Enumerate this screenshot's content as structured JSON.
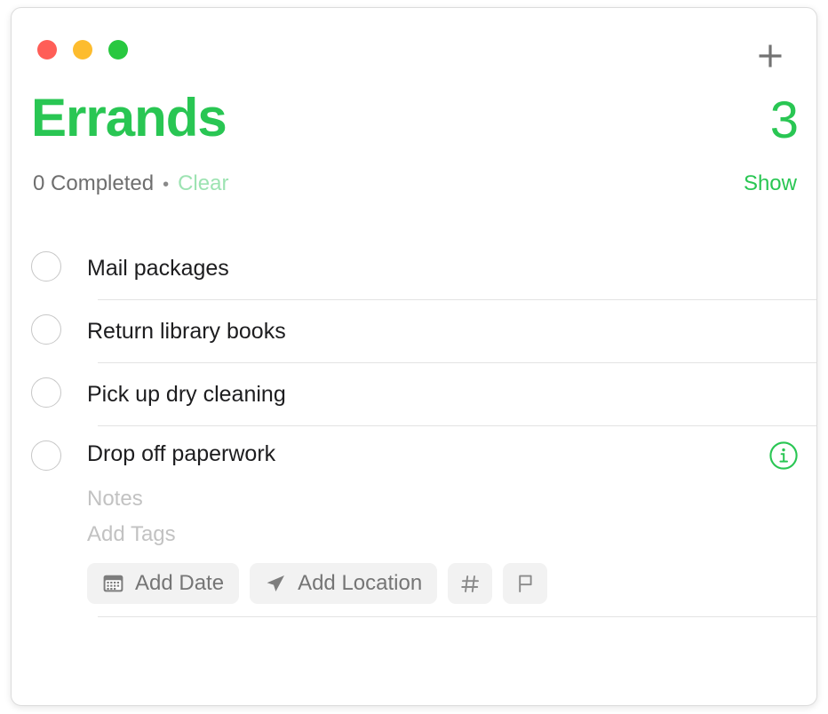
{
  "window": {
    "traffic_lights": [
      {
        "name": "close",
        "color": "#ff5e57"
      },
      {
        "name": "minimize",
        "color": "#fdbc2e"
      },
      {
        "name": "maximize",
        "color": "#28c840"
      }
    ],
    "add_icon": "plus-icon"
  },
  "header": {
    "title": "Errands",
    "count": "3",
    "accent_color": "#29c653"
  },
  "meta": {
    "completed_label": "0 Completed",
    "separator_dot": "•",
    "clear_label": "Clear",
    "clear_color": "#9de3b2",
    "show_label": "Show"
  },
  "tasks": [
    {
      "title": "Mail packages",
      "checked": false
    },
    {
      "title": "Return library books",
      "checked": false
    },
    {
      "title": "Pick up dry cleaning",
      "checked": false
    },
    {
      "title": "Drop off paperwork",
      "checked": false,
      "expanded": true,
      "notes_placeholder": "Notes",
      "tags_placeholder": "Add Tags",
      "info_icon": "info-circle-icon",
      "chips": [
        {
          "label": "Add Date",
          "icon": "calendar-icon"
        },
        {
          "label": "Add Location",
          "icon": "location-arrow-icon"
        },
        {
          "label": "",
          "icon": "hashtag-icon"
        },
        {
          "label": "",
          "icon": "flag-icon"
        }
      ]
    }
  ]
}
